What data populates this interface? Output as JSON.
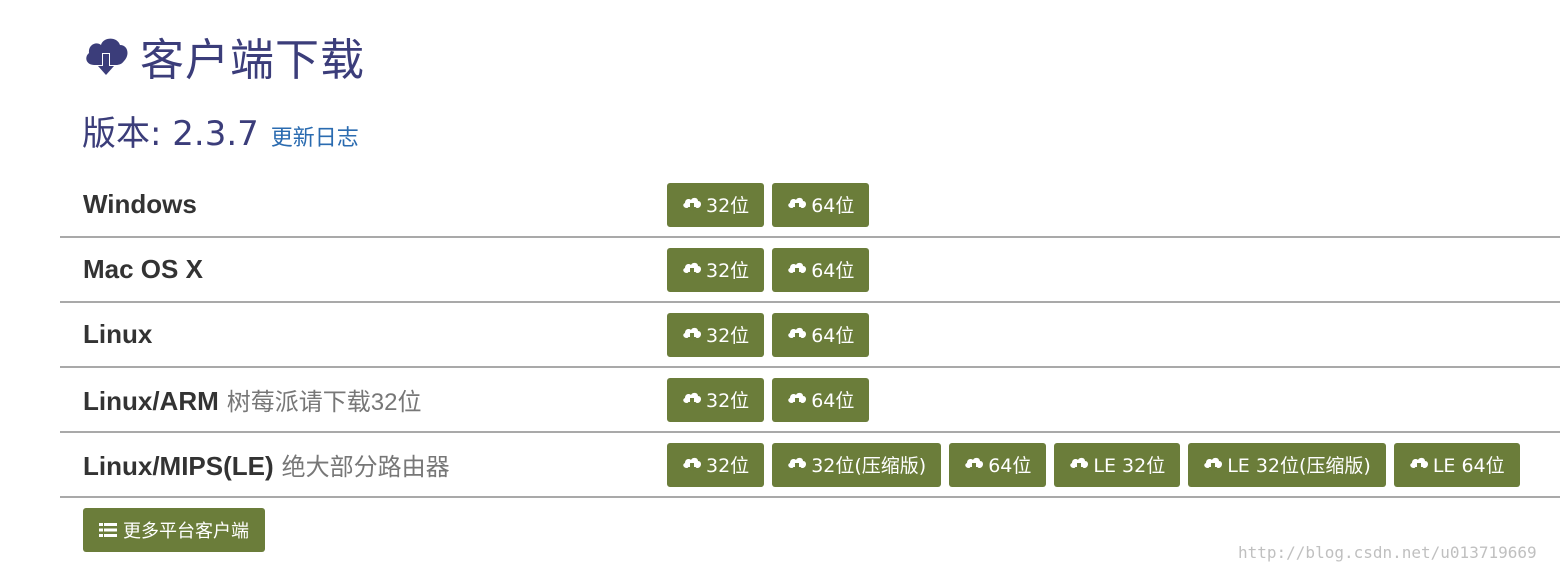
{
  "header": {
    "title": "客户端下载",
    "icon": "cloud-download-icon",
    "accent_color": "#3b3d7a"
  },
  "version": {
    "label": "版本: 2.3.7",
    "changelog_link": "更新日志",
    "link_color": "#2a6bb0"
  },
  "button_color": "#6b7d3a",
  "platforms": [
    {
      "name": "Windows",
      "note": "",
      "buttons": [
        "32位",
        "64位"
      ]
    },
    {
      "name": "Mac OS X",
      "note": "",
      "buttons": [
        "32位",
        "64位"
      ]
    },
    {
      "name": "Linux",
      "note": "",
      "buttons": [
        "32位",
        "64位"
      ]
    },
    {
      "name": "Linux/ARM",
      "note": "树莓派请下载32位",
      "buttons": [
        "32位",
        "64位"
      ]
    },
    {
      "name": "Linux/MIPS(LE)",
      "note": "绝大部分路由器",
      "buttons": [
        "32位",
        "32位(压缩版)",
        "64位",
        "LE 32位",
        "LE 32位(压缩版)",
        "LE 64位"
      ]
    }
  ],
  "more_button": {
    "label": "更多平台客户端",
    "icon": "list-icon"
  },
  "watermark": "http://blog.csdn.net/u013719669"
}
